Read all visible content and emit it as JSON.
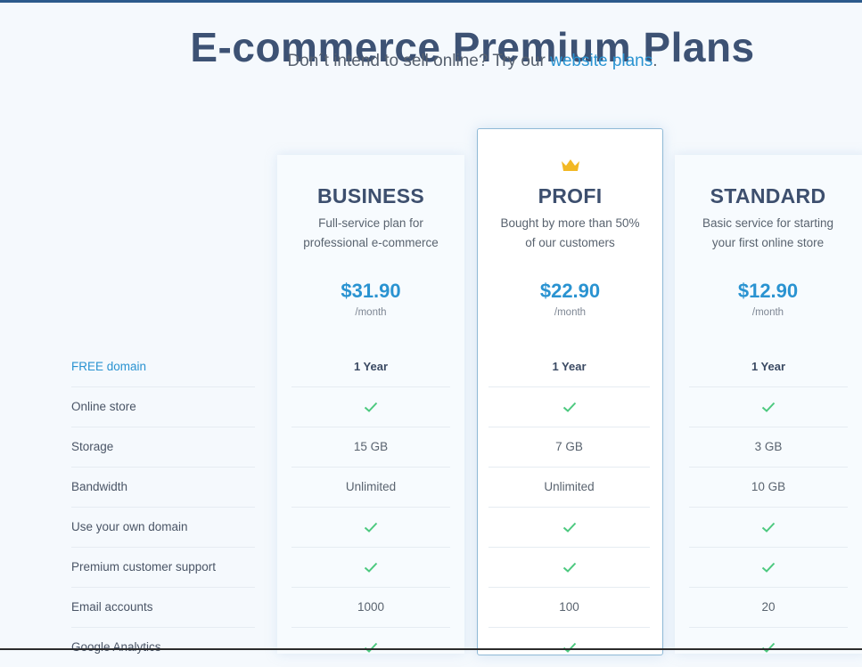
{
  "header": {
    "title": "E-commerce Premium Plans",
    "subtitle_prefix": "Don´t intend to sell online? Try our ",
    "subtitle_link": "website plans",
    "subtitle_suffix": "."
  },
  "colors": {
    "accent": "#2a93d1",
    "check": "#4cc97f",
    "crown": "#f2b824",
    "title": "#3d5274"
  },
  "features": [
    "FREE domain",
    "Online store",
    "Storage",
    "Bandwidth",
    "Use your own domain",
    "Premium customer support",
    "Email accounts",
    "Google Analytics"
  ],
  "plans": [
    {
      "name": "BUSINESS",
      "desc_line1": "Full-service plan for",
      "desc_line2": "professional e-commerce",
      "price": "$31.90",
      "period": "/month",
      "featured": false,
      "values": [
        "1 Year",
        "check-icon",
        "15 GB",
        "Unlimited",
        "check-icon",
        "check-icon",
        "1000",
        "check-icon"
      ]
    },
    {
      "name": "PROFI",
      "desc_line1": "Bought by more than 50%",
      "desc_line2": "of our customers",
      "price": "$22.90",
      "period": "/month",
      "featured": true,
      "badge_icon": "crown-icon",
      "values": [
        "1 Year",
        "check-icon",
        "7 GB",
        "Unlimited",
        "check-icon",
        "check-icon",
        "100",
        "check-icon"
      ]
    },
    {
      "name": "STANDARD",
      "desc_line1": "Basic service for starting",
      "desc_line2": "your first online store",
      "price": "$12.90",
      "period": "/month",
      "featured": false,
      "values": [
        "1 Year",
        "check-icon",
        "3 GB",
        "10 GB",
        "check-icon",
        "check-icon",
        "20",
        "check-icon"
      ]
    }
  ]
}
